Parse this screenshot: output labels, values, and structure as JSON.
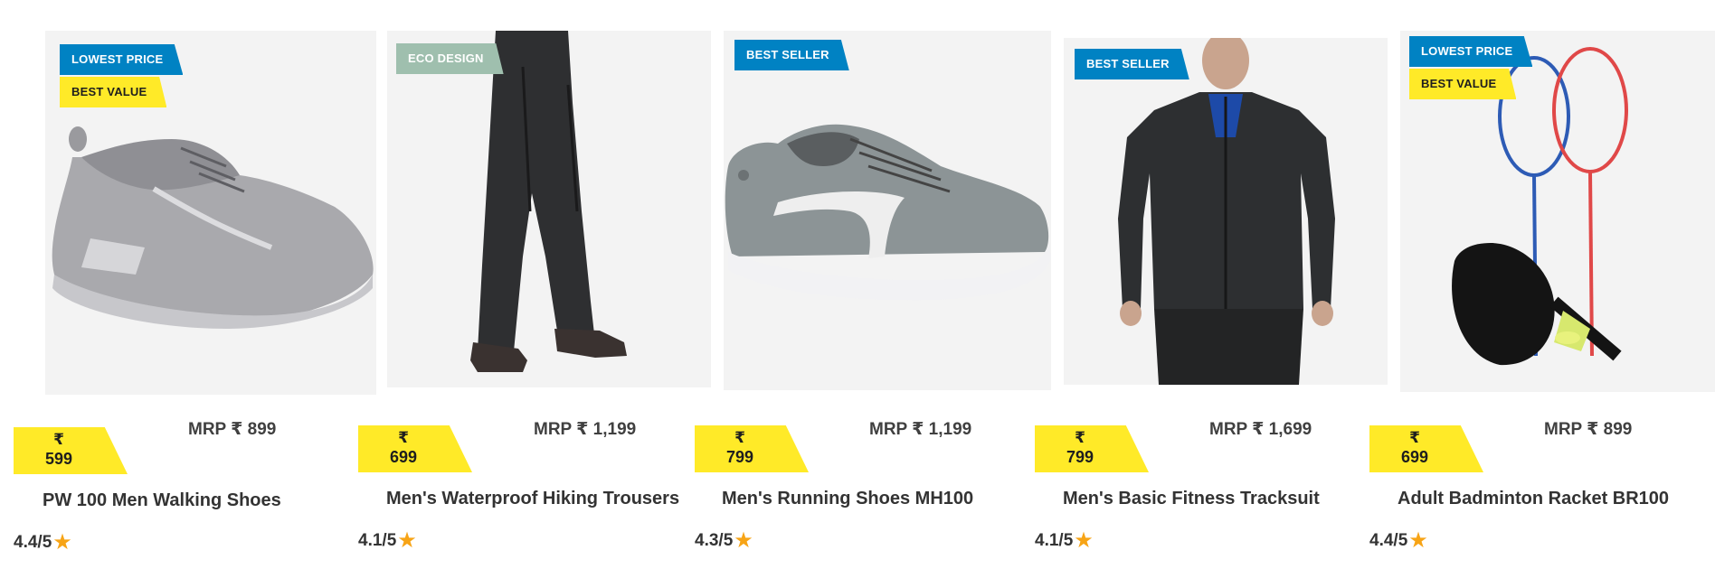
{
  "currency_symbol": "₹",
  "colors": {
    "blue_badge": "#0082c3",
    "yellow_badge": "#ffea28",
    "eco_badge": "#9fbfae",
    "star": "#f7a416"
  },
  "products": [
    {
      "badges": [
        "LOWEST PRICE",
        "BEST VALUE"
      ],
      "price": "599",
      "mrp": "MRP ₹ 899",
      "title": "PW 100 Men Walking Shoes",
      "rating": "4.4/5",
      "image": "grey-walking-shoe"
    },
    {
      "badges": [
        "ECO DESIGN"
      ],
      "price": "699",
      "mrp": "MRP ₹ 1,199",
      "title": "Men's Waterproof Hiking Trousers",
      "rating": "4.1/5",
      "image": "black-trousers"
    },
    {
      "badges": [
        "BEST SELLER"
      ],
      "price": "799",
      "mrp": "MRP ₹ 1,199",
      "title": "Men's Running Shoes MH100",
      "rating": "4.3/5",
      "image": "grey-running-shoe"
    },
    {
      "badges": [
        "BEST SELLER"
      ],
      "price": "799",
      "mrp": "MRP ₹ 1,699",
      "title": "Men's Basic Fitness Tracksuit",
      "rating": "4.1/5",
      "image": "black-tracksuit"
    },
    {
      "badges": [
        "LOWEST PRICE",
        "BEST VALUE"
      ],
      "price": "699",
      "mrp": "MRP ₹ 899",
      "title": "Adult Badminton Racket BR100",
      "rating": "4.4/5",
      "image": "badminton-rackets"
    }
  ]
}
